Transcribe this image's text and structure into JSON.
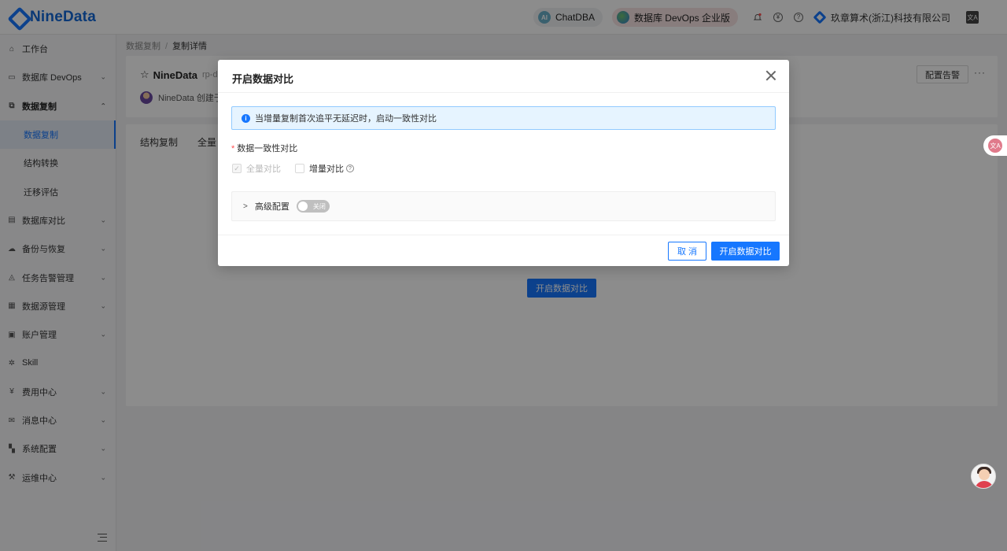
{
  "app": {
    "logo_text": "NineData"
  },
  "header": {
    "chatdba_label": "ChatDBA",
    "chatdba_icon_text": "AI",
    "devops_label": "数据库 DevOps 企业版",
    "company": "玖章算术(浙江)科技有限公司",
    "currency_icon": "¥",
    "help_icon": "?",
    "lang_icon_text": "文A"
  },
  "sidebar": {
    "items": [
      {
        "label": "工作台",
        "icon": "home-icon"
      },
      {
        "label": "数据库 DevOps",
        "icon": "monitor-icon"
      },
      {
        "label": "数据复制",
        "icon": "copy-icon"
      },
      {
        "label": "数据复制"
      },
      {
        "label": "结构转换"
      },
      {
        "label": "迁移评估"
      },
      {
        "label": "数据库对比",
        "icon": "compare-icon"
      },
      {
        "label": "备份与恢复",
        "icon": "cloud-icon"
      },
      {
        "label": "任务告警管理",
        "icon": "alarm-icon"
      },
      {
        "label": "数据源管理",
        "icon": "database-icon"
      },
      {
        "label": "账户管理",
        "icon": "account-icon"
      },
      {
        "label": "Skill",
        "icon": "skill-icon"
      },
      {
        "label": "费用中心",
        "icon": "yen-icon"
      },
      {
        "label": "消息中心",
        "icon": "mail-icon"
      },
      {
        "label": "系统配置",
        "icon": "grid-icon"
      },
      {
        "label": "运维中心",
        "icon": "wrench-icon"
      }
    ]
  },
  "breadcrumb": {
    "parent": "数据复制",
    "separator": "/",
    "current": "复制详情"
  },
  "task": {
    "name": "NineData",
    "id_prefix": "rp-d",
    "creator_text": "NineData 创建于",
    "alarm_button": "配置告警",
    "more": "···"
  },
  "tabs": [
    "结构复制",
    "全量"
  ],
  "main_button": "开启数据对比",
  "modal": {
    "title": "开启数据对比",
    "alert_text": "当增量复制首次追平无延迟时，启动一致性对比",
    "field_label": "数据一致性对比",
    "full_compare_label": "全量对比",
    "incremental_compare_label": "增量对比",
    "advanced_label": "高级配置",
    "switch_label": "关闭",
    "cancel_label": "取 消",
    "ok_label": "开启数据对比"
  },
  "float": {
    "translate_text": "文A"
  },
  "colors": {
    "primary": "#1677ff",
    "required": "#ff4d4f",
    "alert_bg": "#e6f4ff"
  }
}
